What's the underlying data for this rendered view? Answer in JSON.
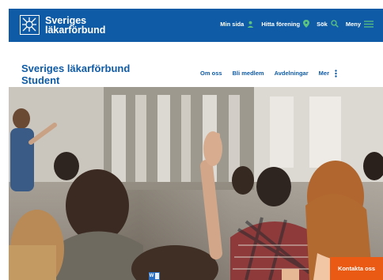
{
  "header": {
    "logo_line1": "Sveriges",
    "logo_line2": "läkarförbund",
    "nav": [
      {
        "label": "Min sida",
        "icon": "person-icon"
      },
      {
        "label": "Hitta förening",
        "icon": "location-pin-icon"
      },
      {
        "label": "Sök",
        "icon": "search-icon"
      },
      {
        "label": "Meny",
        "icon": "hamburger-menu-icon"
      }
    ]
  },
  "subheader": {
    "title_line1": "Sveriges läkarförbund",
    "title_line2": "Student",
    "nav": [
      "Om oss",
      "Bli medlem",
      "Avdelningar",
      "Mer"
    ]
  },
  "floating": {
    "contact_label": "Kontakta oss",
    "doc_letter": "W"
  },
  "colors": {
    "brand_blue": "#0f5ba6",
    "accent_green": "#5cc27f",
    "contact_orange": "#ea5a14"
  }
}
